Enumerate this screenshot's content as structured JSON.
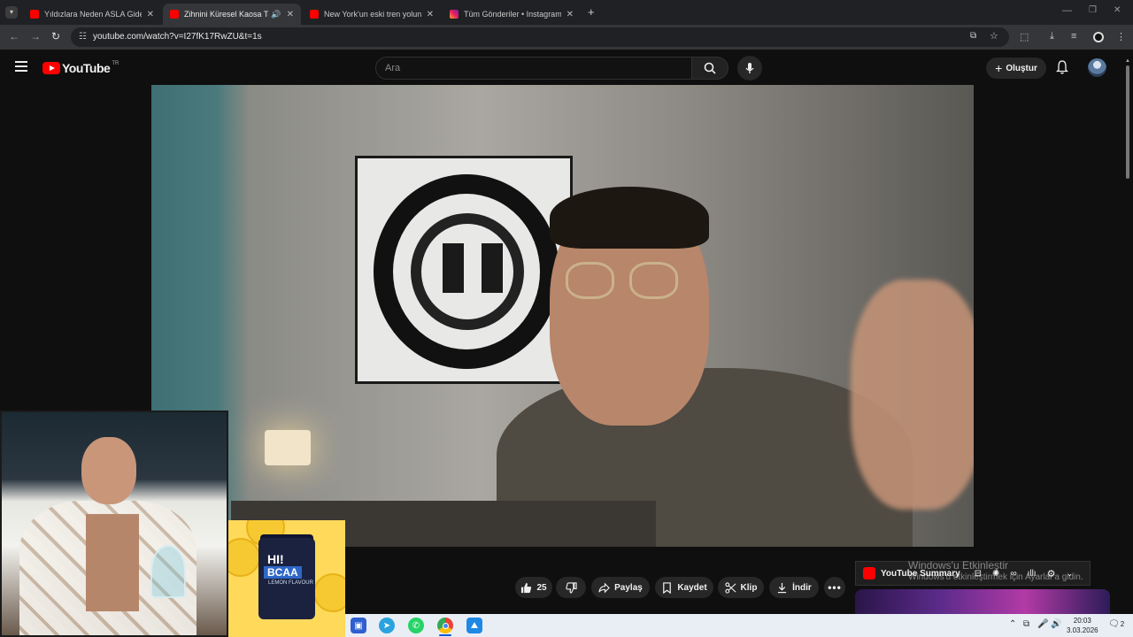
{
  "browser": {
    "tabs": [
      {
        "title": "Yıldızlara Neden ASLA Gidemeyi",
        "icon": "youtube-favicon"
      },
      {
        "title": "Zihnini Küresel Kaosa Teslim",
        "icon": "youtube-favicon",
        "active": true
      },
      {
        "title": "New York'un eski tren yolunda",
        "icon": "youtube-favicon"
      },
      {
        "title": "Tüm Gönderiler • Instagram",
        "icon": "instagram-favicon"
      }
    ],
    "url": "youtube.com/watch?v=I27fK17RwZU&t=1s"
  },
  "youtube": {
    "logo_text": "YouTube",
    "region": "TR",
    "search_placeholder": "Ara",
    "create_label": "Oluştur"
  },
  "actions": {
    "likes": "25",
    "share": "Paylaş",
    "save": "Kaydet",
    "clip": "Klip",
    "download": "İndir"
  },
  "ad": {
    "brand": "HI!",
    "product": "BCAA",
    "flavor": "LEMON FLAVOUR"
  },
  "side": {
    "summary_label": "YouTube Summary"
  },
  "watermark": {
    "title": "Windows'u Etkinleştir",
    "subtitle": "Windows'u etkinleştirmek için Ayarlar'a gidin."
  },
  "taskbar": {
    "time": "20:03",
    "date": "3.03.2026",
    "notifications": "2"
  },
  "colors": {
    "yt_red": "#ff0000",
    "background": "#0f0f0f",
    "chip": "#272727"
  }
}
